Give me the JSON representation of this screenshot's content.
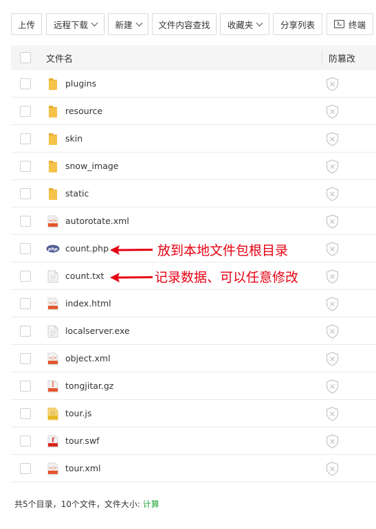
{
  "toolbar": {
    "upload": "上传",
    "remote_download": "远程下载",
    "new": "新建",
    "content_search": "文件内容查找",
    "favorites": "收藏夹",
    "share_list": "分享列表",
    "terminal": "终端"
  },
  "table": {
    "col_name": "文件名",
    "col_protect": "防篡改",
    "rows": [
      {
        "name": "plugins",
        "icon": "folder-icon"
      },
      {
        "name": "resource",
        "icon": "folder-icon"
      },
      {
        "name": "skin",
        "icon": "folder-icon"
      },
      {
        "name": "snow_image",
        "icon": "folder-icon"
      },
      {
        "name": "static",
        "icon": "folder-icon"
      },
      {
        "name": "autorotate.xml",
        "icon": "xml-file-icon"
      },
      {
        "name": "count.php",
        "icon": "php-file-icon"
      },
      {
        "name": "count.txt",
        "icon": "text-file-icon"
      },
      {
        "name": "index.html",
        "icon": "html-file-icon"
      },
      {
        "name": "localserver.exe",
        "icon": "text-file-icon"
      },
      {
        "name": "object.xml",
        "icon": "xml-file-icon"
      },
      {
        "name": "tongjitar.gz",
        "icon": "zip-file-icon"
      },
      {
        "name": "tour.js",
        "icon": "js-file-icon"
      },
      {
        "name": "tour.swf",
        "icon": "swf-file-icon"
      },
      {
        "name": "tour.xml",
        "icon": "xml-file-icon"
      }
    ]
  },
  "annotations": {
    "php_note": "放到本地文件包根目录",
    "txt_note": "记录数据、可以任意修改"
  },
  "footer": {
    "summary": "共5个目录，10个文件，文件大小:",
    "calc_link": "计算"
  },
  "colors": {
    "annotation_red": "#e60012",
    "calc_green": "#20a53a",
    "folder_yellow": "#f5c24a"
  }
}
